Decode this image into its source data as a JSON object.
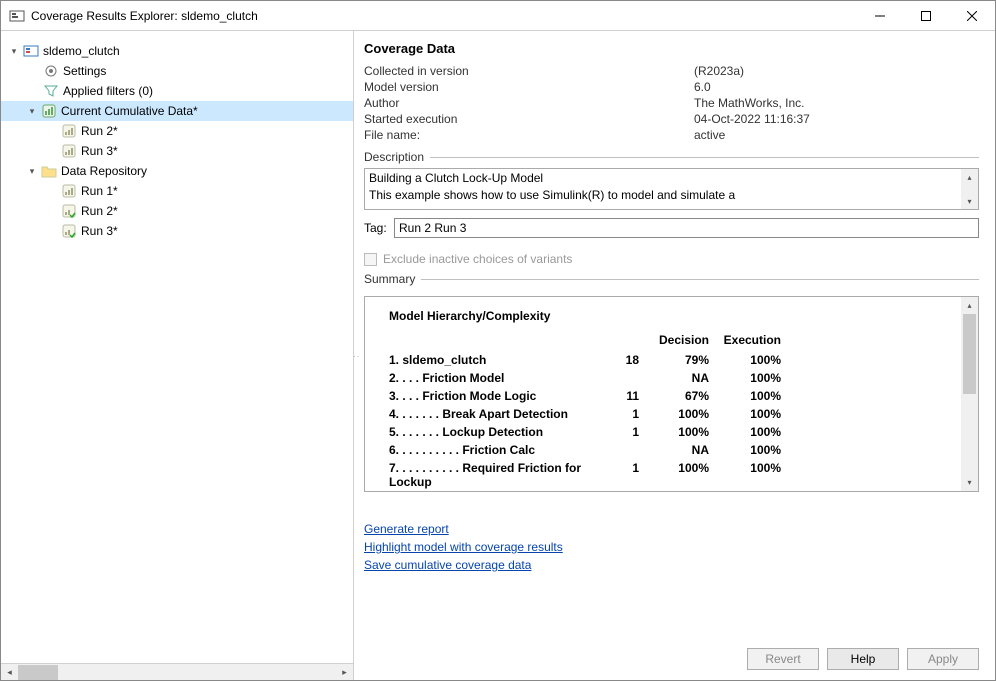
{
  "window": {
    "title": "Coverage Results Explorer: sldemo_clutch"
  },
  "tree": {
    "root": "sldemo_clutch",
    "settings": "Settings",
    "applied_filters": "Applied filters (0)",
    "current_cumulative": "Current Cumulative Data*",
    "ccd_run2": "Run 2*",
    "ccd_run3": "Run 3*",
    "data_repository": "Data Repository",
    "dr_run1": "Run 1*",
    "dr_run2": "Run 2*",
    "dr_run3": "Run 3*"
  },
  "header": "Coverage Data",
  "meta": {
    "collected_label": "Collected in version",
    "collected_value": "(R2023a)",
    "model_label": "Model version",
    "model_value": "6.0",
    "author_label": "Author",
    "author_value": "The MathWorks, Inc.",
    "started_label": "Started execution",
    "started_value": "04-Oct-2022 11:16:37",
    "filename_label": "File name:",
    "filename_value": "active"
  },
  "description": {
    "label": "Description",
    "line1": "Building a Clutch Lock-Up Model",
    "line2": "This example shows how to use Simulink(R) to model and simulate a"
  },
  "tag": {
    "label": "Tag:",
    "value": "Run 2 Run 3"
  },
  "checkbox": {
    "label": "Exclude inactive choices of variants"
  },
  "summary": {
    "label": "Summary",
    "heading": "Model Hierarchy/Complexity",
    "col_decision": "Decision",
    "col_execution": "Execution",
    "rows": [
      {
        "n": "1. sldemo_clutch",
        "c": "18",
        "d": "79%",
        "e": "100%"
      },
      {
        "n": "2. . . . Friction Model",
        "c": "",
        "d": "NA",
        "e": "100%"
      },
      {
        "n": "3. . . . Friction Mode Logic",
        "c": "11",
        "d": "67%",
        "e": "100%"
      },
      {
        "n": "4. . . . . . . Break Apart Detection",
        "c": "1",
        "d": "100%",
        "e": "100%"
      },
      {
        "n": "5. . . . . . . Lockup Detection",
        "c": "1",
        "d": "100%",
        "e": "100%"
      },
      {
        "n": "6. . . . . . . . . . Friction Calc",
        "c": "",
        "d": "NA",
        "e": "100%"
      },
      {
        "n": "7. . . . . . . . . . Required Friction for Lockup",
        "c": "1",
        "d": "100%",
        "e": "100%"
      }
    ]
  },
  "links": {
    "generate": "Generate report",
    "highlight": "Highlight model with coverage results",
    "save": "Save cumulative coverage data"
  },
  "buttons": {
    "revert": "Revert",
    "help": "Help",
    "apply": "Apply"
  }
}
